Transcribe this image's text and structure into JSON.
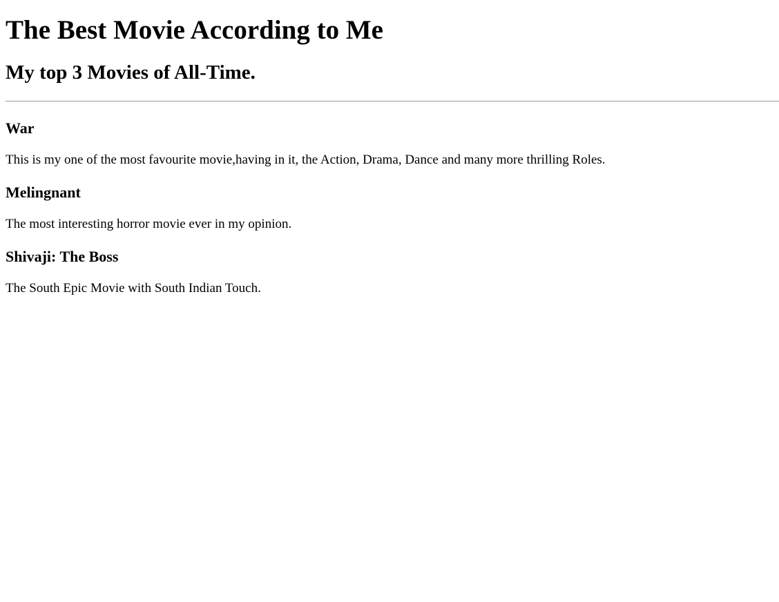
{
  "page": {
    "title": "The Best Movie According to Me",
    "subtitle": "My top 3 Movies of All-Time."
  },
  "movies": [
    {
      "name": "War",
      "description": "This is my one of the most favourite movie,having in it, the Action, Drama, Dance and many more thrilling Roles."
    },
    {
      "name": "Melingnant",
      "description": "The most interesting horror movie ever in my opinion."
    },
    {
      "name": "Shivaji: The Boss",
      "description": "The South Epic Movie with South Indian Touch."
    }
  ]
}
